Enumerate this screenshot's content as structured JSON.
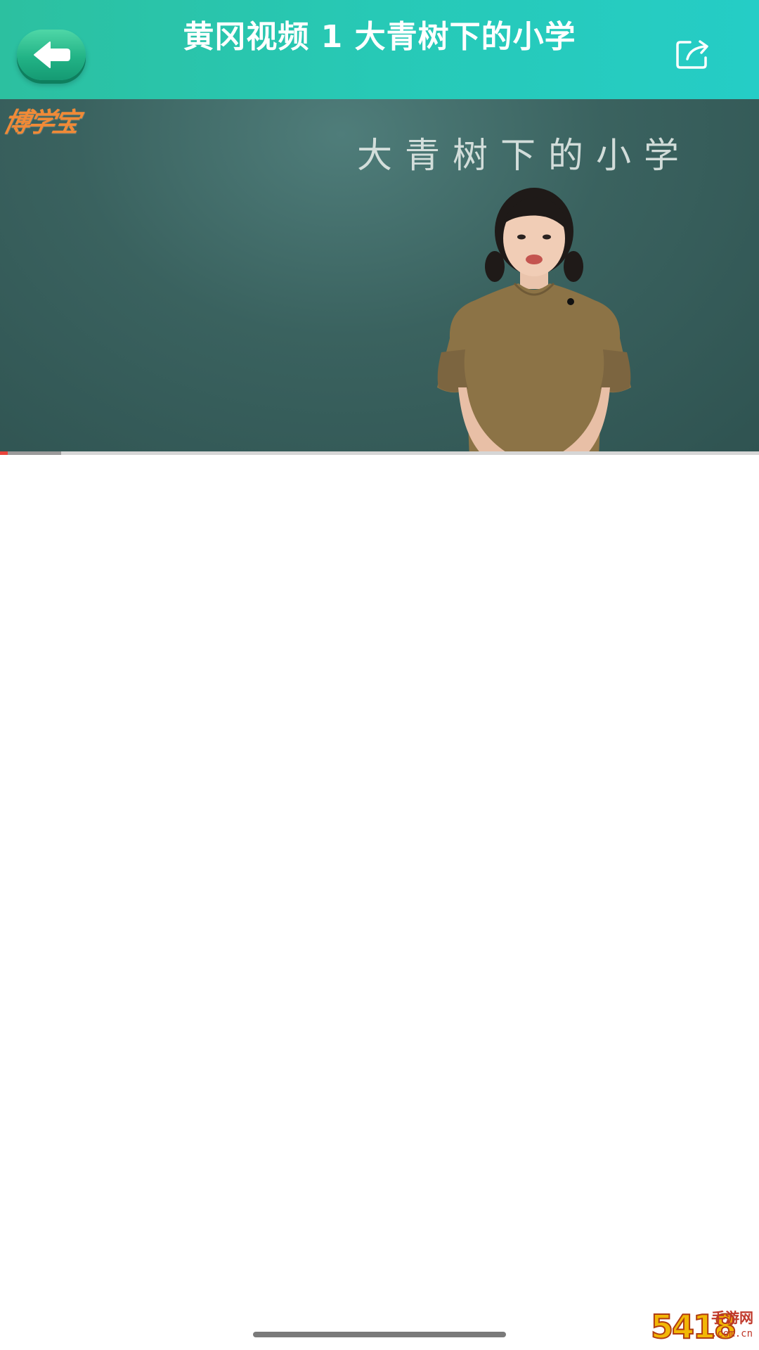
{
  "header": {
    "title": "黄冈视频 1 大青树下的小学",
    "back_icon": "arrow-left-icon",
    "share_icon": "share-icon"
  },
  "video": {
    "logo_text": "博学宝",
    "board_text": "大青树下的小学",
    "progress_fraction": 0.01,
    "buffer_fraction": 0.08,
    "colors": {
      "progress": "#e8433a",
      "logo": "#f08a37"
    }
  },
  "watermark": {
    "number": "5418",
    "text": "手游网",
    "domain": ".com.cn"
  },
  "colors": {
    "header": "#27c9b6",
    "back_button": "#22b386"
  }
}
